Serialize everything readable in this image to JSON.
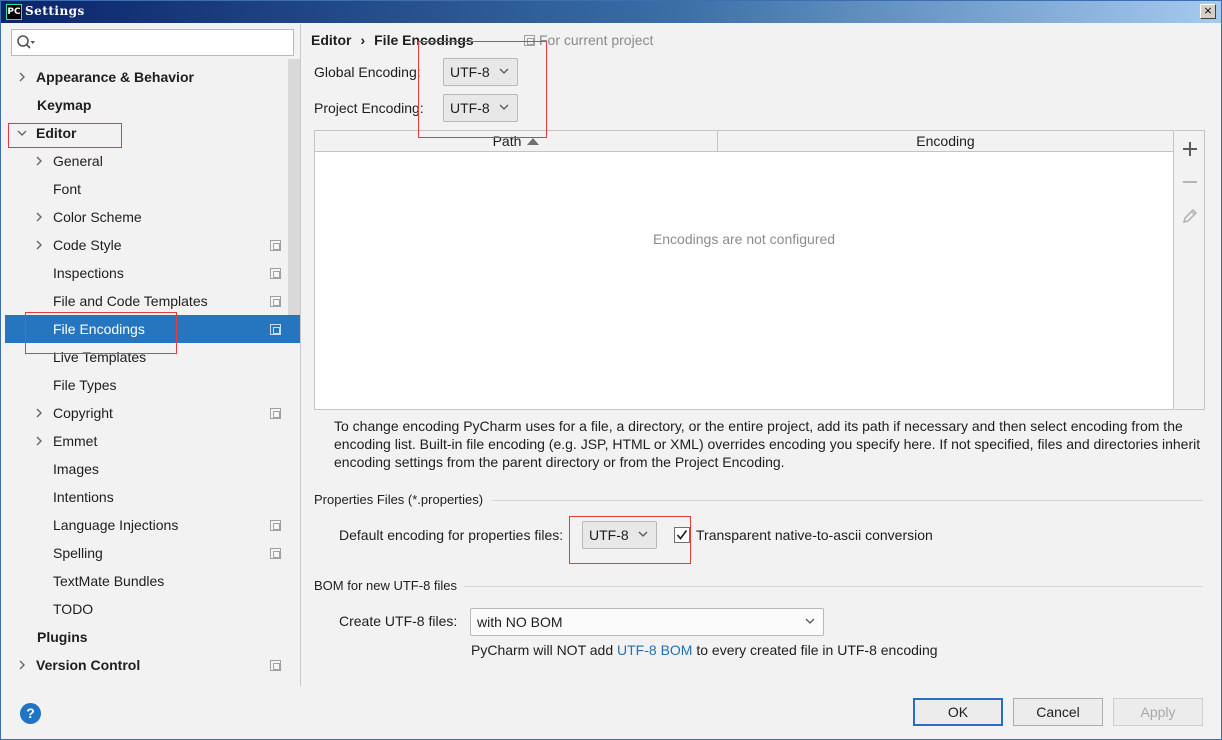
{
  "window": {
    "title": "Settings",
    "app_icon_text": "PC",
    "close_glyph": "×"
  },
  "search": {
    "placeholder": ""
  },
  "sidebar": {
    "items": [
      {
        "label": "Appearance & Behavior",
        "bold": true,
        "expander": "collapsed",
        "indent": 0
      },
      {
        "label": "Keymap",
        "bold": true,
        "expander": "none",
        "indent": 0
      },
      {
        "label": "Editor",
        "bold": true,
        "expander": "expanded",
        "indent": 0
      },
      {
        "label": "General",
        "bold": false,
        "expander": "collapsed",
        "indent": 1
      },
      {
        "label": "Font",
        "bold": false,
        "expander": "none",
        "indent": 1
      },
      {
        "label": "Color Scheme",
        "bold": false,
        "expander": "collapsed",
        "indent": 1
      },
      {
        "label": "Code Style",
        "bold": false,
        "expander": "collapsed",
        "indent": 1,
        "project_icon": true
      },
      {
        "label": "Inspections",
        "bold": false,
        "expander": "none",
        "indent": 1,
        "project_icon": true
      },
      {
        "label": "File and Code Templates",
        "bold": false,
        "expander": "none",
        "indent": 1,
        "project_icon": true
      },
      {
        "label": "File Encodings",
        "bold": false,
        "expander": "none",
        "indent": 1,
        "project_icon": true,
        "selected": true
      },
      {
        "label": "Live Templates",
        "bold": false,
        "expander": "none",
        "indent": 1
      },
      {
        "label": "File Types",
        "bold": false,
        "expander": "none",
        "indent": 1
      },
      {
        "label": "Copyright",
        "bold": false,
        "expander": "collapsed",
        "indent": 1,
        "project_icon": true
      },
      {
        "label": "Emmet",
        "bold": false,
        "expander": "collapsed",
        "indent": 1
      },
      {
        "label": "Images",
        "bold": false,
        "expander": "none",
        "indent": 1
      },
      {
        "label": "Intentions",
        "bold": false,
        "expander": "none",
        "indent": 1
      },
      {
        "label": "Language Injections",
        "bold": false,
        "expander": "none",
        "indent": 1,
        "project_icon": true
      },
      {
        "label": "Spelling",
        "bold": false,
        "expander": "none",
        "indent": 1,
        "project_icon": true
      },
      {
        "label": "TextMate Bundles",
        "bold": false,
        "expander": "none",
        "indent": 1
      },
      {
        "label": "TODO",
        "bold": false,
        "expander": "none",
        "indent": 1
      },
      {
        "label": "Plugins",
        "bold": true,
        "expander": "none",
        "indent": 0
      },
      {
        "label": "Version Control",
        "bold": true,
        "expander": "collapsed",
        "indent": 0,
        "project_icon": true
      }
    ]
  },
  "breadcrumb": {
    "parent": "Editor",
    "separator": "›",
    "current": "File Encodings",
    "note": "For current project"
  },
  "global_encoding": {
    "label": "Global Encoding:",
    "value": "UTF-8"
  },
  "project_encoding": {
    "label": "Project Encoding:",
    "value": "UTF-8"
  },
  "table": {
    "columns": [
      "Path",
      "Encoding"
    ],
    "sorted_column": "Path",
    "sort_direction": "ascending",
    "empty_text": "Encodings are not configured",
    "tools": [
      "add-icon",
      "remove-icon",
      "edit-icon"
    ]
  },
  "help_text": "To change encoding PyCharm uses for a file, a directory, or the entire project, add its path if necessary and then select encoding from the encoding list. Built-in file encoding (e.g. JSP, HTML or XML) overrides encoding you specify here. If not specified, files and directories inherit encoding settings from the parent directory or from the Project Encoding.",
  "properties_section": {
    "title": "Properties Files (*.properties)",
    "default_label": "Default encoding for properties files:",
    "default_value": "UTF-8",
    "checkbox_label": "Transparent native-to-ascii conversion",
    "checkbox_checked": true
  },
  "bom_section": {
    "title": "BOM for new UTF-8 files",
    "create_label": "Create UTF-8 files:",
    "create_value": "with NO BOM",
    "note_prefix": "PyCharm will NOT add ",
    "note_link": "UTF-8 BOM",
    "note_suffix": " to every created file in UTF-8 encoding"
  },
  "footer": {
    "help_glyph": "?",
    "ok": "OK",
    "cancel": "Cancel",
    "apply": "Apply"
  },
  "colors": {
    "selection": "#2675bf",
    "link": "#2470b3",
    "annotation_red": "#e53b3b",
    "help_button": "#1f74c5"
  }
}
